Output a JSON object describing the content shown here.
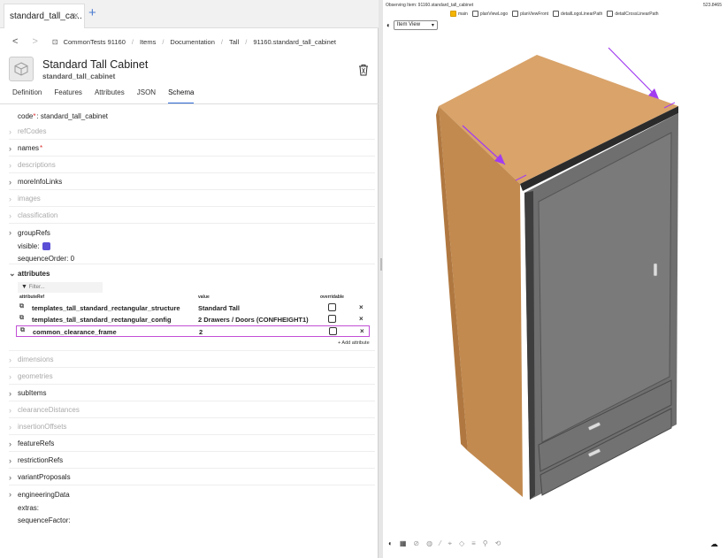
{
  "tab": {
    "label": "standard_tall_ca...",
    "close": "×",
    "add": "+"
  },
  "breadcrumb": {
    "back": "<",
    "forward": ">",
    "items": [
      "CommonTests 91160",
      "Items",
      "Documentation",
      "Tall",
      "91160.standard_tall_cabinet"
    ]
  },
  "header": {
    "title": "Standard Tall Cabinet",
    "subtitle": "standard_tall_cabinet"
  },
  "subtabs": [
    "Definition",
    "Features",
    "Attributes",
    "JSON",
    "Schema"
  ],
  "active_subtab": "Schema",
  "schema": {
    "code_label": "code",
    "code_req": "*",
    "code_value": ": standard_tall_cabinet",
    "rows": {
      "refCodes": "refCodes",
      "names": "names",
      "names_req": "*",
      "descriptions": "descriptions",
      "moreInfoLinks": "moreInfoLinks",
      "images": "images",
      "classification": "classification",
      "groupRefs": "groupRefs",
      "attributes": "attributes",
      "dimensions": "dimensions",
      "geometries": "geometries",
      "subItems": "subItems",
      "clearanceDistances": "clearanceDistances",
      "insertionOffsets": "insertionOffsets",
      "featureRefs": "featureRefs",
      "restrictionRefs": "restrictionRefs",
      "variantProposals": "variantProposals",
      "engineeringData": "engineeringData"
    },
    "visible_label": "visible:",
    "sequenceOrder": "sequenceOrder:  0",
    "extras": "extras:",
    "sequenceFactor": "sequenceFactor:",
    "filter_placeholder": "Filter...",
    "columns": {
      "attributeRef": "attributeRef",
      "value": "value",
      "overridable": "overridable"
    },
    "attribute_rows": [
      {
        "name": "templates_tall_standard_rectangular_structure",
        "value": "Standard Tall",
        "remove": "×"
      },
      {
        "name": "templates_tall_standard_rectangular_config",
        "value": "2 Drawers / Doors (CONFHEIGHT1)",
        "remove": "×"
      },
      {
        "name": "common_clearance_frame",
        "value": "2",
        "remove": "×"
      }
    ],
    "add_attribute": "+ Add attribute"
  },
  "viewer": {
    "observing": "Observing Item: 91160.standard_tall_cabinet",
    "right_number": "523.8465",
    "layers": [
      {
        "label": "main",
        "checked": true
      },
      {
        "label": "planViewLogo",
        "checked": false
      },
      {
        "label": "planViewFront",
        "checked": false
      },
      {
        "label": "detailLogoLinearPath",
        "checked": false
      },
      {
        "label": "detailCrossLinearPath",
        "checked": false
      }
    ],
    "view_select": "Item View",
    "view_arrow": "▾",
    "eye": "◐",
    "tools": [
      "◐",
      "▦",
      "⊘",
      "◍",
      "⁄",
      "⌖",
      "◇",
      "≡",
      "⚲",
      "⟲"
    ],
    "cloud": "☁"
  },
  "colors": {
    "accent": "#2f6bd6",
    "highlight": "#c24fd6",
    "wood": "#d8a169",
    "door": "#6c6c6c",
    "arrow": "#a23cf0"
  }
}
